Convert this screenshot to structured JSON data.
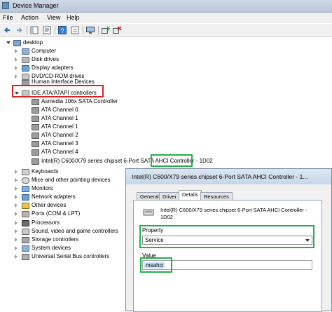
{
  "window": {
    "title": "Device Manager"
  },
  "menu": [
    "File",
    "Action",
    "View",
    "Help"
  ],
  "tree": {
    "root": "desktop",
    "before": [
      "Computer",
      "Disk drives",
      "Display adapters",
      "DVD/CD-ROM drives",
      "Human Interface Devices"
    ],
    "expanded": "IDE ATA/ATAPI controllers",
    "children": [
      "Asmedia 106x SATA Controller",
      "ATA Channel 0",
      "ATA Channel 1",
      "ATA Channel 1",
      "ATA Channel 2",
      "ATA Channel 3",
      "ATA Channel 4"
    ],
    "intel_prefix": "Intel(R) C600/X79 series chipset 6-Port SATA ",
    "intel_highlight": "AHCI Controller",
    "intel_suffix": " - 1D02",
    "after": [
      "Keyboards",
      "Mice and other pointing devices",
      "Monitors",
      "Network adapters",
      "Other devices",
      "Ports (COM & LPT)",
      "Processors",
      "Sound, video and game controllers",
      "Storage controllers",
      "System devices",
      "Universal Serial Bus controllers"
    ]
  },
  "dialog": {
    "title": "Intel(R) C600/X79 series chipset 6-Port SATA AHCI Controller - 1...",
    "tabs": [
      "General",
      "Driver",
      "Details",
      "Resources"
    ],
    "active_tab": "Details",
    "device_name_line1": "Intel(R) C600/X79 series chipset 6-Port SATA AHCI Controller -",
    "device_name_line2": "1D02",
    "property_label": "Property",
    "property_value": "Service",
    "value_label": "Value",
    "value": "msahci"
  },
  "colors": {
    "highlight_red": "#e02020",
    "highlight_green": "#22b04a",
    "selection": "#cde0f5"
  }
}
